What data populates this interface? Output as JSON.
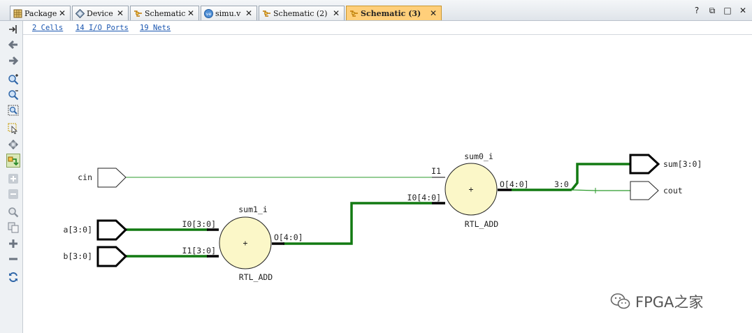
{
  "tabs": [
    {
      "label": "Package",
      "icon": "package-icon",
      "active": false
    },
    {
      "label": "Device",
      "icon": "device-icon",
      "active": false
    },
    {
      "label": "Schematic",
      "icon": "schematic-icon",
      "active": false
    },
    {
      "label": "simu.v",
      "icon": "verilog-file-icon",
      "active": false
    },
    {
      "label": "Schematic (2)",
      "icon": "schematic-icon",
      "active": false
    },
    {
      "label": "Schematic (3)",
      "icon": "schematic-icon",
      "active": true
    }
  ],
  "tab_close_glyph": "✕",
  "window_controls": {
    "help": "?",
    "restore": "⧉",
    "maximize": "□",
    "close": "✕"
  },
  "info": {
    "cells": "2 Cells",
    "io_ports": "14 I/O Ports",
    "nets": "19 Nets"
  },
  "toolbar_icons": [
    "dock-icon",
    "back-arrow-icon",
    "forward-arrow-icon",
    "zoom-in-icon",
    "zoom-out-icon",
    "zoom-fit-icon",
    "select-area-icon",
    "move-icon",
    "auto-route-icon",
    "expand-icon",
    "collapse-icon",
    "search-icon",
    "copy-icon",
    "add-icon",
    "remove-icon",
    "refresh-icon"
  ],
  "schematic": {
    "ports": {
      "cin": "cin",
      "a": "a[3:0]",
      "b": "b[3:0]",
      "sum": "sum[3:0]",
      "cout": "cout"
    },
    "cells": [
      {
        "name": "sum1_i",
        "type": "RTL_ADD",
        "symbol": "+",
        "pins": {
          "in0": "I0[3:0]",
          "in1": "I1[3:0]",
          "out": "O[4:0]"
        }
      },
      {
        "name": "sum0_i",
        "type": "RTL_ADD",
        "symbol": "+",
        "pins": {
          "in0": "I0[4:0]",
          "in1": "I1",
          "out": "O[4:0]"
        }
      }
    ],
    "slice_label": "3:0",
    "colors": {
      "bus": "#127a12",
      "net": "#2b9b2b",
      "cell_fill": "#fbf7c8"
    }
  },
  "watermark": "FPGA之家"
}
